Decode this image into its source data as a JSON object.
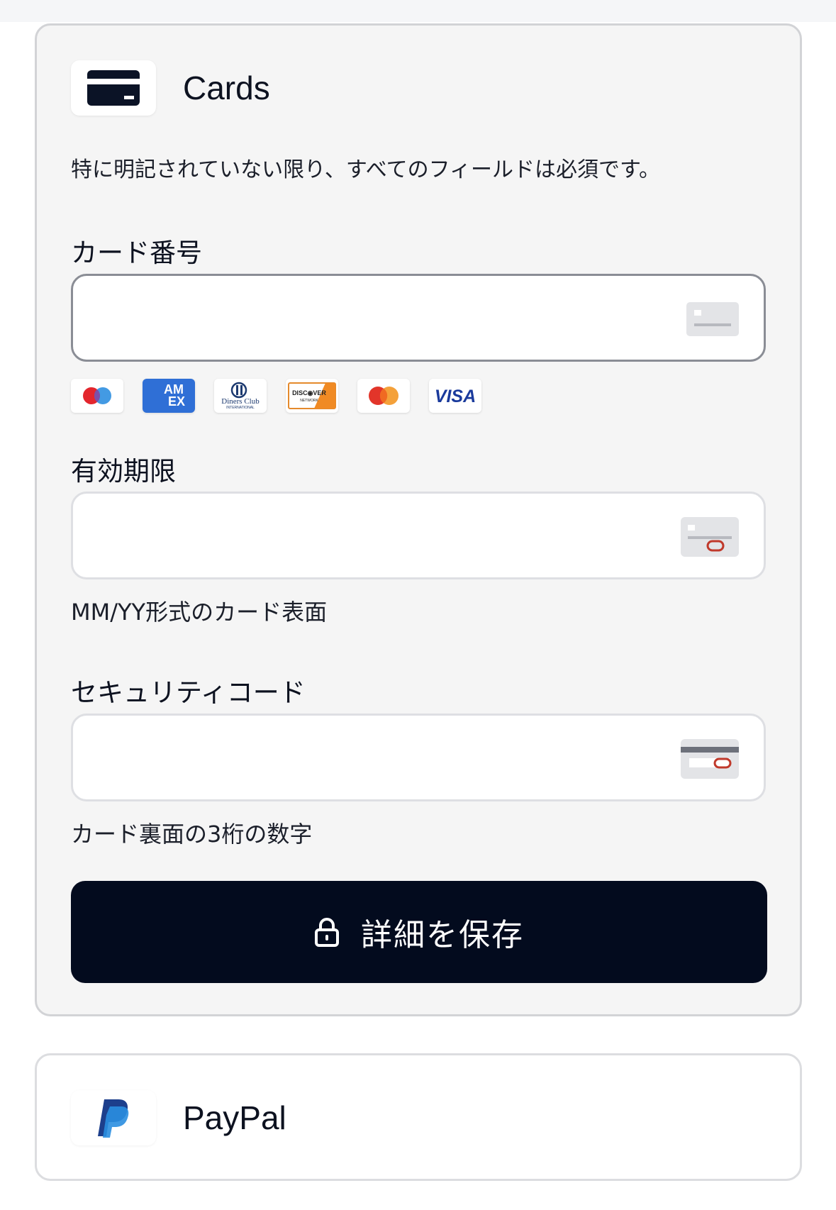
{
  "cards_section": {
    "title": "Cards",
    "required_note": "特に明記されていない限り、すべてのフィールドは必須です。",
    "card_number": {
      "label": "カード番号",
      "value": "",
      "placeholder": ""
    },
    "brands": [
      "Maestro",
      "AMEX",
      "Diners Club International",
      "Discover Network",
      "Mastercard",
      "VISA"
    ],
    "expiry": {
      "label": "有効期限",
      "value": "",
      "placeholder": "",
      "help": "MM/YY形式のカード表面"
    },
    "cvc": {
      "label": "セキュリティコード",
      "value": "",
      "placeholder": "",
      "help": "カード裏面の3桁の数字"
    },
    "save_button": "詳細を保存"
  },
  "paypal_section": {
    "title": "PayPal"
  },
  "colors": {
    "button_bg": "#030b1e",
    "section_bg": "#f5f5f5",
    "border": "#d2d3d6"
  },
  "icons": [
    "credit-card-icon",
    "card-front-icon",
    "card-expiry-icon",
    "card-back-cvc-icon",
    "lock-icon",
    "paypal-logo"
  ]
}
